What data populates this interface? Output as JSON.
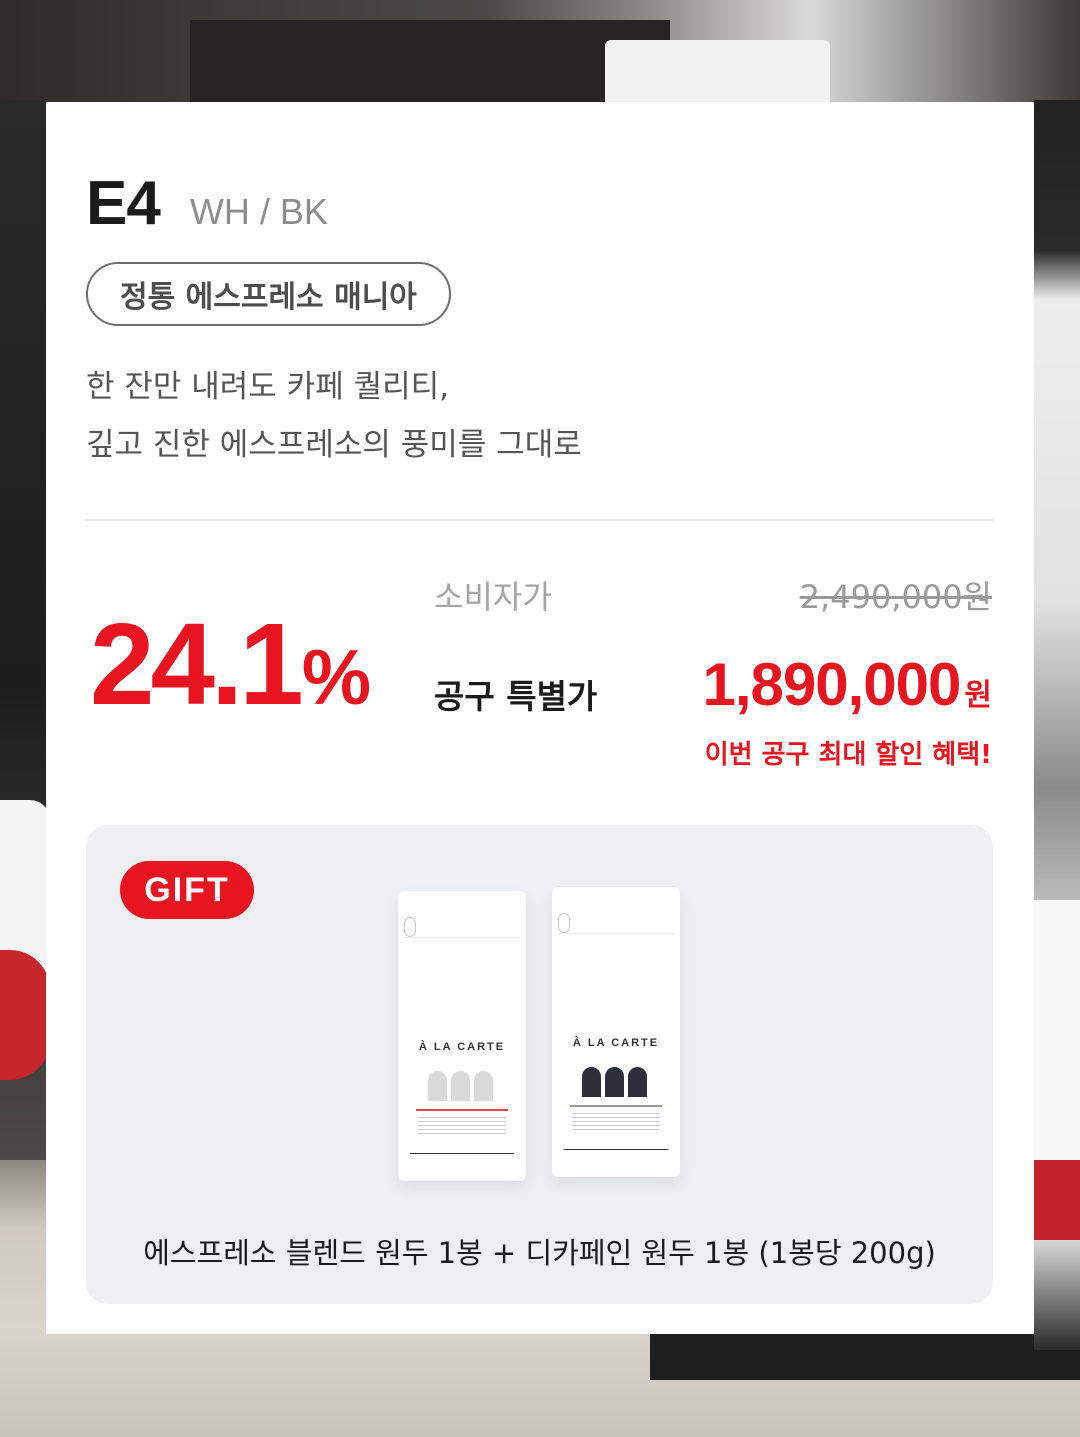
{
  "product": {
    "model": "E4",
    "color": "WH / BK",
    "tag": "정통 에스프레소 매니아",
    "description": [
      "한 잔만 내려도 카페 퀄리티,",
      "깊고 진한 에스프레소의 풍미를 그대로"
    ]
  },
  "pricing": {
    "discount_number": "24.1",
    "discount_unit": "%",
    "retail_label": "소비자가",
    "retail_price": "2,490,000원",
    "special_label": "공구 특별가",
    "special_price": "1,890,000",
    "special_currency": "원",
    "promo_text": "이번 공구 최대 할인 혜택!",
    "accent_color": "#e8141f"
  },
  "gift": {
    "badge": "GIFT",
    "bag_brand": "À LA CARTE",
    "caption": "에스프레소 블렌드 원두 1봉 + 디카페인 원두 1봉 (1봉당 200g)"
  }
}
